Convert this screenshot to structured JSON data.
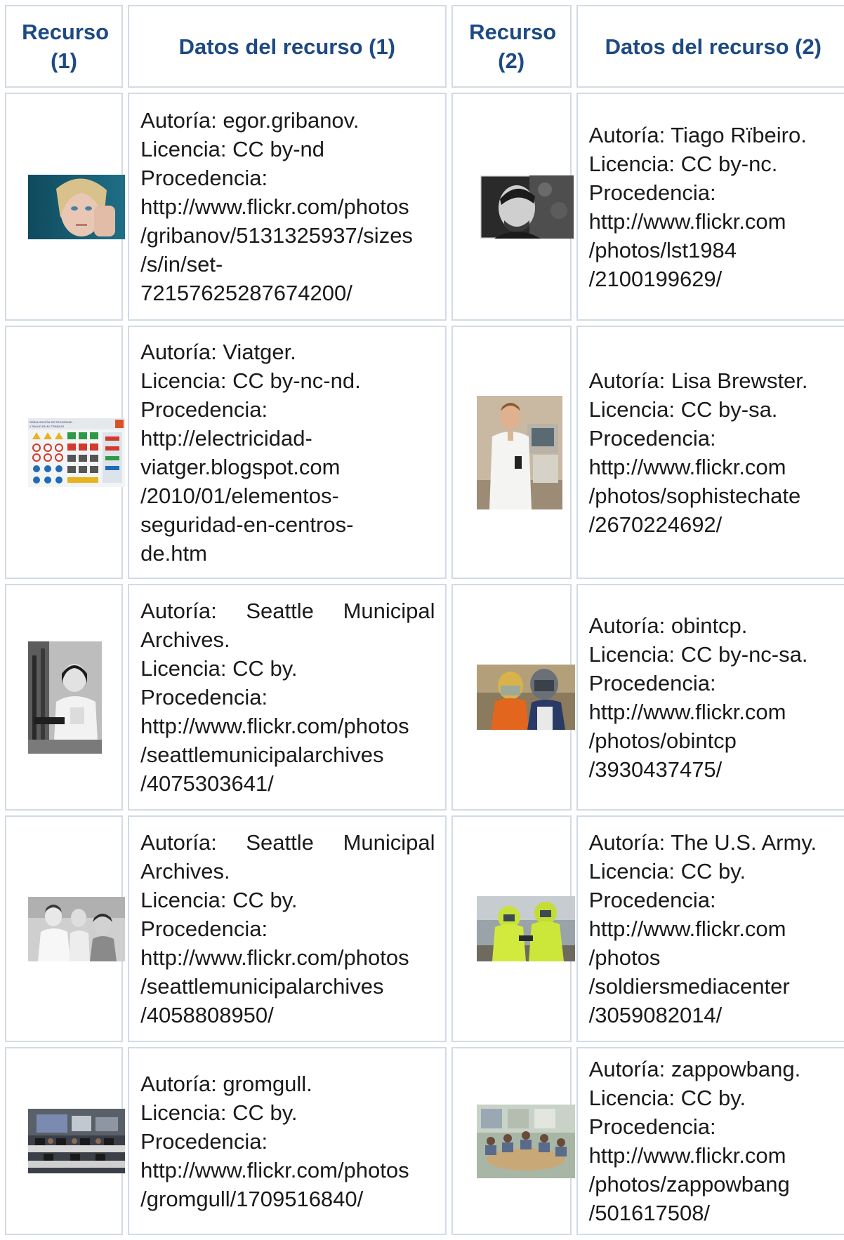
{
  "headers": {
    "col1": "Recurso (1)",
    "col2": "Datos del recurso (1)",
    "col3": "Recurso (2)",
    "col4": "Datos del recurso (2)"
  },
  "rows": [
    {
      "left": {
        "image": "portrait-woman-hand-on-face",
        "lines": [
          "Autoría: egor.gribanov.",
          "Licencia: CC by-nd",
          "Procedencia:",
          "http://www.flickr.com/photos",
          "/gribanov/5131325937/sizes",
          "/s/in/set-",
          "72157625287674200/"
        ]
      },
      "right": {
        "image": "portrait-smiling-man-bw",
        "lines": [
          "Autoría: Tiago Rïbeiro.",
          "Licencia: CC by-nc.",
          "Procedencia:",
          "http://www.flickr.com",
          "/photos/lst1984",
          "/2100199629/"
        ]
      }
    },
    {
      "left": {
        "image": "safety-signage-poster",
        "poster_title": "SEÑALIZACIÓN DE SEGURIDAD Y SALUD EN EL TRABAJO",
        "lines": [
          "Autoría: Viatger.",
          "Licencia: CC by-nc-nd.",
          "Procedencia:",
          "http://electricidad-",
          "viatger.blogspot.com",
          "/2010/01/elementos-",
          "seguridad-en-centros-",
          "de.htm"
        ]
      },
      "right": {
        "image": "man-in-lab-coat",
        "lines": [
          "Autoría: Lisa Brewster.",
          "Licencia: CC by-sa.",
          "Procedencia:",
          "http://www.flickr.com",
          "/photos/sophistechate",
          "/2670224692/"
        ]
      }
    },
    {
      "left": {
        "image": "woman-at-microscope-bw",
        "first_line_words": [
          "Autoría:",
          "Seattle",
          "Municipal"
        ],
        "lines": [
          "Archives.",
          "Licencia: CC by.",
          "Procedencia:",
          "http://www.flickr.com/photos",
          "/seattlemunicipalarchives",
          "/4075303641/"
        ]
      },
      "right": {
        "image": "protective-helmet-mannequins",
        "lines": [
          "Autoría: obintcp.",
          "Licencia: CC by-nc-sa.",
          "Procedencia:",
          "http://www.flickr.com",
          "/photos/obintcp",
          "/3930437475/"
        ]
      }
    },
    {
      "left": {
        "image": "doctors-with-patient-bw",
        "first_line_words": [
          "Autoría:",
          "Seattle",
          "Municipal"
        ],
        "lines": [
          "Archives.",
          "Licencia: CC by.",
          "Procedencia:",
          "http://www.flickr.com/photos",
          "/seattlemunicipalarchives",
          "/4058808950/"
        ]
      },
      "right": {
        "image": "yellow-hazmat-suits",
        "lines": [
          "Autoría: The U.S. Army.",
          "Licencia: CC by.",
          "Procedencia:",
          "http://www.flickr.com",
          "/photos",
          "/soldiersmediacenter",
          "/3059082014/"
        ]
      }
    },
    {
      "left": {
        "image": "computer-classroom",
        "lines": [
          "Autoría: gromgull.",
          "Licencia: CC by.",
          "Procedencia:",
          "http://www.flickr.com/photos",
          "/gromgull/1709516840/"
        ]
      },
      "right": {
        "image": "meeting-room-group",
        "lines": [
          "Autoría: zappowbang.",
          "Licencia: CC by.",
          "Procedencia:",
          "http://www.flickr.com",
          "/photos/zappowbang",
          "/501617508/"
        ]
      }
    }
  ]
}
